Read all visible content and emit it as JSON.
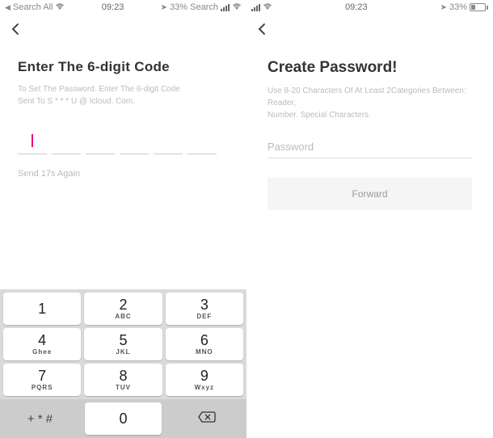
{
  "statusbar": {
    "left_tri": "◀",
    "left_text": "Search All",
    "time": "09:23",
    "right_loc": "➤",
    "right_pct_search": "33% Search",
    "right_pct": "33%"
  },
  "left_screen": {
    "title": "Enter The 6-digit Code",
    "subtitle1": "To Set The Password. Enter The 6-digit Code",
    "subtitle2": "Sent To S * * * U @ Icloud. Com.",
    "resend": "Send 17s Again"
  },
  "right_screen": {
    "title": "Create Password!",
    "subtitle1": "Use 8-20 Characters Of At Least 2Categories Between: Reader,",
    "subtitle2": "Number. Special Characters.",
    "placeholder": "Password",
    "forward": "Forward"
  },
  "keypad": {
    "k1": {
      "n": "1",
      "l": ""
    },
    "k2": {
      "n": "2",
      "l": "ABC"
    },
    "k3": {
      "n": "3",
      "l": "DEF"
    },
    "k4": {
      "n": "4",
      "l": "Ghee"
    },
    "k5": {
      "n": "5",
      "l": "JKL"
    },
    "k6": {
      "n": "6",
      "l": "MNO"
    },
    "k7": {
      "n": "7",
      "l": "PQRS"
    },
    "k8": {
      "n": "8",
      "l": "TUV"
    },
    "k9": {
      "n": "9",
      "l": "Wxyz"
    },
    "ksym": "+ * #",
    "k0": "0",
    "kback": "⌫"
  }
}
